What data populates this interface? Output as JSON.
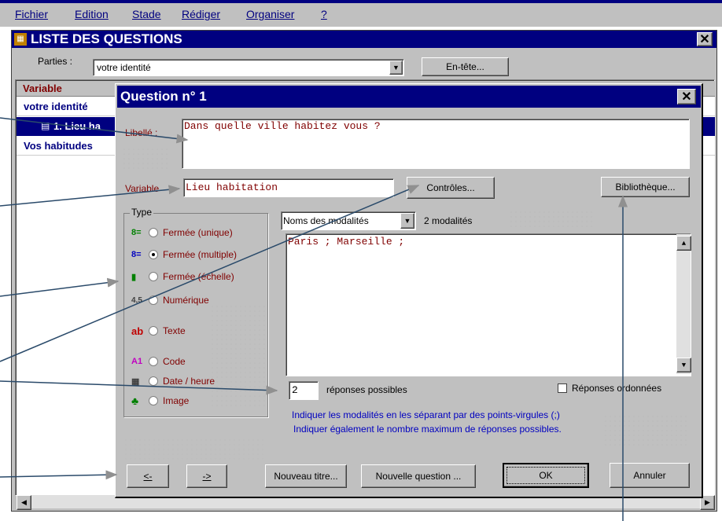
{
  "menu": [
    "Fichier",
    "Edition",
    "Stade",
    "Rédiger",
    "Organiser",
    "?"
  ],
  "list_window": {
    "title": "LISTE DES QUESTIONS",
    "parties_label": "Parties :",
    "parties_value": "votre identité",
    "entete_button": "En-tête...",
    "column_header": "Variable",
    "rows": [
      "votre identité",
      "1. Lieu ha",
      "Vos habitudes"
    ]
  },
  "dialog": {
    "title": "Question n° 1",
    "libelle_label": "Libellé :",
    "libelle_value": "Dans quelle ville habitez vous ?",
    "variable_label": "Variable",
    "variable_value": "Lieu habitation",
    "controles_button": "Contrôles...",
    "bibliotheque_button": "Bibliothèque...",
    "type_group_label": "Type",
    "types": [
      {
        "icon": "8=",
        "label": "Fermée (unique)",
        "selected": false
      },
      {
        "icon": "8=",
        "label": "Fermée (multiple)",
        "selected": true
      },
      {
        "icon": "▮",
        "label": "Fermée (échelle)",
        "selected": false
      },
      {
        "icon": "4,5",
        "label": "Numérique",
        "selected": false
      },
      {
        "icon": "ab",
        "label": "Texte",
        "selected": false
      },
      {
        "icon": "A1",
        "label": "Code",
        "selected": false
      },
      {
        "icon": "▦",
        "label": "Date / heure",
        "selected": false
      },
      {
        "icon": "♣",
        "label": "Image",
        "selected": false
      }
    ],
    "modalites_select": "Noms des modalités",
    "modalites_count": "2 modalités",
    "modalites_text": "Paris ; Marseille ;",
    "responses_value": "2",
    "responses_label": "réponses possibles",
    "ordered_label": "Réponses ordonnées",
    "hint_line1": "Indiquer les modalités en les séparant par des points-virgules (;)",
    "hint_line2": "Indiquer également le nombre maximum de réponses possibles.",
    "prev_button": "<-",
    "next_button": "->",
    "new_title_button": "Nouveau titre...",
    "new_question_button": "Nouvelle question ...",
    "ok_button": "OK",
    "cancel_button": "Annuler"
  },
  "colors": {
    "title_bar": "#000080",
    "dialog_bg": "#c0c0c0",
    "label_red": "#800000",
    "hint_blue": "#0000c0"
  }
}
